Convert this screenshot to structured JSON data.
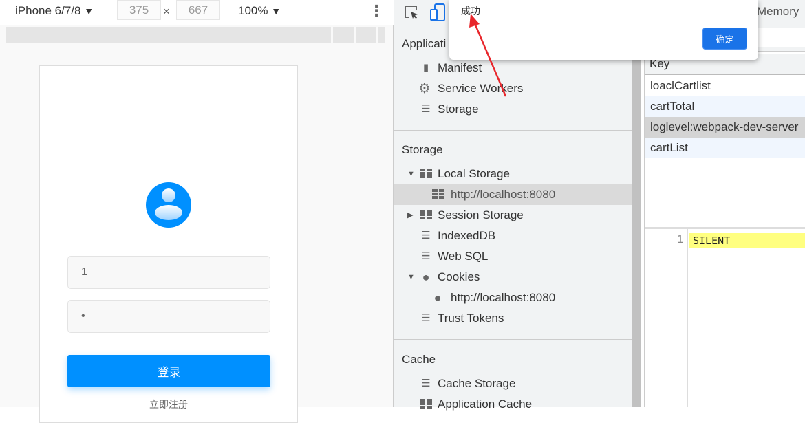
{
  "device_toolbar": {
    "device": "iPhone 6/7/8",
    "width": "375",
    "height": "667",
    "times": "×",
    "zoom": "100%",
    "dropdown_glyph": "▼",
    "more_glyph": "⋮"
  },
  "page": {
    "username_value": "1",
    "password_value": "•",
    "login_label": "登录",
    "register_link": "立即注册",
    "avatar_color": "#0090ff"
  },
  "devtools": {
    "memory_tab": "Memory"
  },
  "sidebar": {
    "application_header": "Applicati",
    "application_items": [
      {
        "label": "Manifest",
        "icon": "file-icon"
      },
      {
        "label": "Service Workers",
        "icon": "gear-icon"
      },
      {
        "label": "Storage",
        "icon": "database-icon"
      }
    ],
    "storage_header": "Storage",
    "storage_items": [
      {
        "label": "Local Storage",
        "icon": "grid-icon",
        "expanded": true
      },
      {
        "label": "http://localhost:8080",
        "icon": "grid-icon",
        "selected": true
      },
      {
        "label": "Session Storage",
        "icon": "grid-icon",
        "expanded": false
      },
      {
        "label": "IndexedDB",
        "icon": "database-icon"
      },
      {
        "label": "Web SQL",
        "icon": "database-icon"
      },
      {
        "label": "Cookies",
        "icon": "cookie-icon",
        "expanded": true
      },
      {
        "label": "http://localhost:8080",
        "icon": "cookie-icon"
      },
      {
        "label": "Trust Tokens",
        "icon": "database-icon"
      }
    ],
    "cache_header": "Cache",
    "cache_items": [
      {
        "label": "Cache Storage",
        "icon": "database-icon"
      },
      {
        "label": "Application Cache",
        "icon": "grid-icon"
      }
    ]
  },
  "table": {
    "key_header": "Key",
    "rows": [
      "loaclCartlist",
      "cartTotal",
      "loglevel:webpack-dev-server",
      "cartList"
    ]
  },
  "editor": {
    "line_number": "1",
    "value": "SILENT"
  },
  "dialog": {
    "message": "成功",
    "ok_label": "确定",
    "ok_color": "#1a73e8"
  },
  "annotation": {
    "arrow_color": "#e8262b"
  }
}
